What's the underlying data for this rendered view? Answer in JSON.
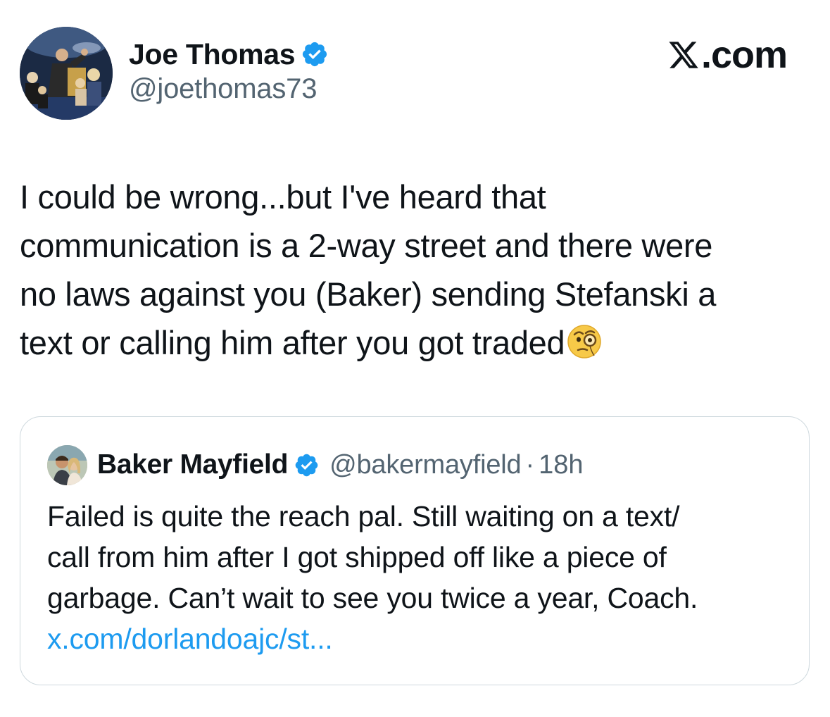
{
  "brand": {
    "text": ".com",
    "logo_icon": "x-logo-icon"
  },
  "author": {
    "display_name": "Joe Thomas",
    "handle": "@joethomas73",
    "verified": true,
    "verified_color": "#1d9bf0"
  },
  "tweet": {
    "lines": [
      "I could be wrong...but I've heard that",
      "communication is a 2-way street and there were",
      "no laws against you (Baker) sending Stefanski a",
      "text or calling him after you got traded"
    ],
    "emoji": "face-with-monocle-icon"
  },
  "quoted_tweet": {
    "display_name": "Baker Mayfield",
    "handle": "@bakermayfield",
    "separator": "·",
    "time": "18h",
    "verified": true,
    "lines": [
      "Failed is quite the reach pal. Still waiting on a text/",
      "call from him after I got shipped off like a piece of",
      "garbage. Can’t wait to see you twice a year, Coach."
    ],
    "link_text": "x.com/dorlandoajc/st..."
  },
  "colors": {
    "text_primary": "#0f1419",
    "text_secondary": "#536471",
    "link": "#1d9bf0",
    "border": "#cfd9de"
  }
}
